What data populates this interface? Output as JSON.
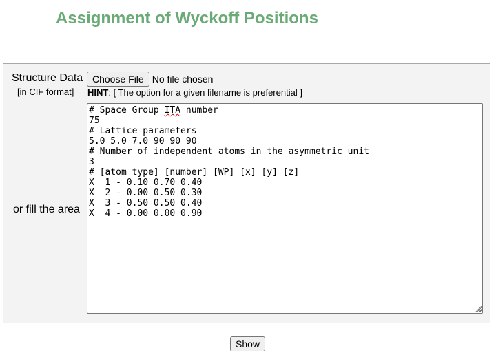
{
  "title": "Assignment of Wyckoff Positions",
  "colors": {
    "accent": "#6aaa77"
  },
  "form": {
    "structure_label": "Structure Data",
    "format_label": "[in CIF format]",
    "fill_label": "or fill the area",
    "choose_file_label": "Choose File",
    "file_status": "No file chosen",
    "hint_label": "HINT",
    "hint_text": ": [ The option for a given filename is preferential ]",
    "textarea_lines": [
      "# Space Group ITA number",
      "75",
      "# Lattice parameters",
      "5.0 5.0 7.0 90 90 90",
      "# Number of independent atoms in the asymmetric unit",
      "3",
      "# [atom type] [number] [WP] [x] [y] [z]",
      "X  1 - 0.10 0.70 0.40",
      "X  2 - 0.00 0.50 0.30",
      "X  3 - 0.50 0.50 0.40",
      "X  4 - 0.00 0.00 0.90"
    ],
    "misspelled_word": "ITA",
    "submit_label": "Show"
  }
}
